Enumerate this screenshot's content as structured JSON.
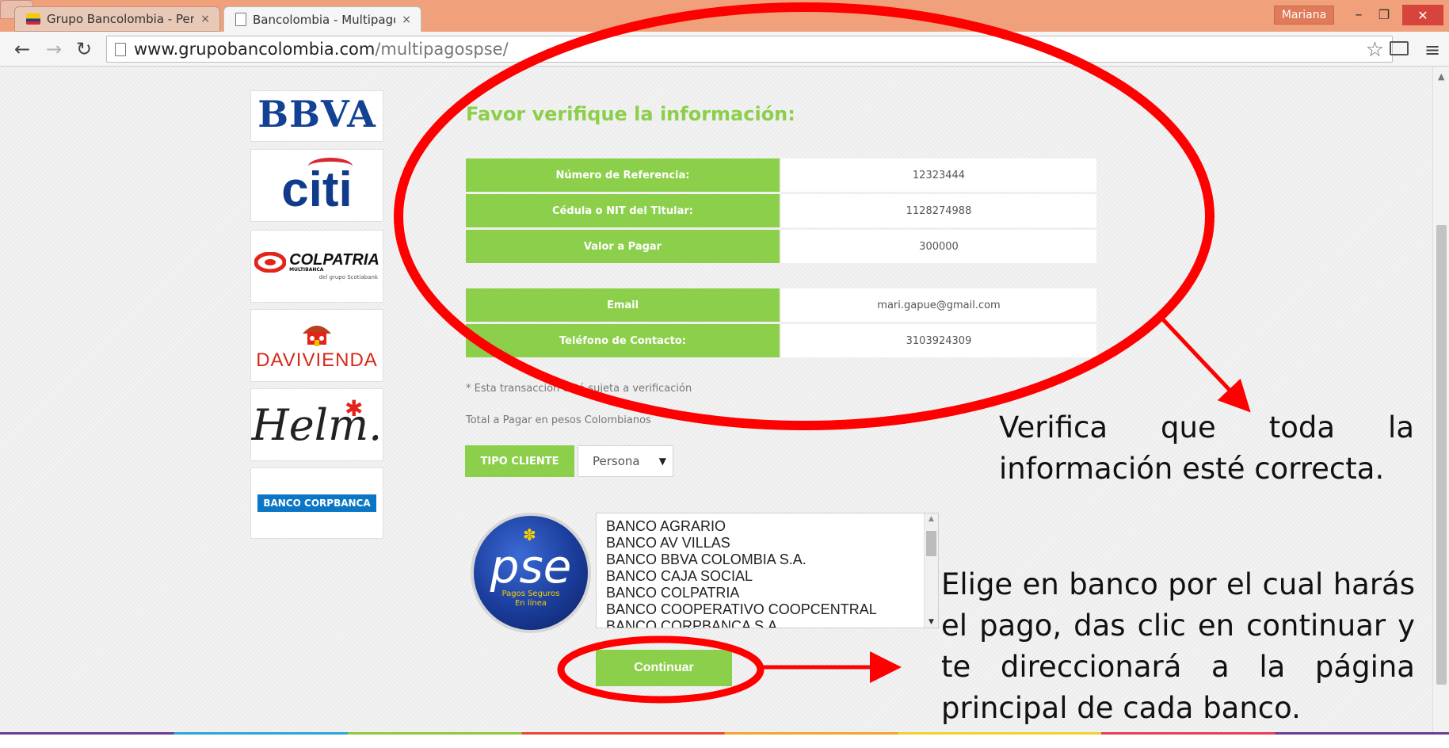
{
  "browser": {
    "tabs": [
      {
        "label": "Grupo Bancolombia - Pers",
        "close": "×"
      },
      {
        "label": "Bancolombia - Multipagos",
        "close": "×"
      }
    ],
    "user": "Mariana",
    "window_buttons": {
      "minimize": "–",
      "maximize": "❐",
      "close": "✕"
    },
    "url_host": "www.grupobancolombia.com",
    "url_path": "/multipagospse/"
  },
  "banks_sidebar": {
    "bbva": "BBVA",
    "citi": "citi",
    "colpatria": "COLPATRIA",
    "colpatria_sub": "MULTIBANCA",
    "colpatria_group": "del grupo Scotiabank",
    "davivienda": "DAVIVIENDA",
    "helm": "Helm.",
    "corpbanca": "BANCO CORPBANCA"
  },
  "verify": {
    "title": "Favor verifique la información:",
    "rows": [
      {
        "label": "Número de Referencia:",
        "value": "12323444"
      },
      {
        "label": "Cédula o NIT del Titular:",
        "value": "1128274988"
      },
      {
        "label": "Valor a Pagar",
        "value": "300000"
      },
      {
        "label": "Email",
        "value": "mari.gapue@gmail.com"
      },
      {
        "label": "Teléfono de Contacto:",
        "value": "3103924309"
      }
    ],
    "note1": "* Esta transacción está sujeta a verificación",
    "note2": "Total a Pagar en pesos Colombianos"
  },
  "client": {
    "tipo_label": "TIPO CLIENTE",
    "tipo_value": "Persona"
  },
  "pse": {
    "word": "pse",
    "sub1": "Pagos Seguros",
    "sub2": "En línea"
  },
  "bank_list": [
    "BANCO AGRARIO",
    "BANCO AV VILLAS",
    "BANCO BBVA COLOMBIA S.A.",
    "BANCO CAJA SOCIAL",
    "BANCO COLPATRIA",
    "BANCO COOPERATIVO COOPCENTRAL",
    "BANCO CORPBANCA S.A"
  ],
  "continue_label": "Continuar",
  "annotations": {
    "first": "Verifica que toda la información esté correcta.",
    "second": "Elige en banco por el cual harás el pago, das clic en continuar y te direccionará a la página principal de cada banco."
  },
  "colors": {
    "green": "#8ccf4a",
    "annotation_red": "#ff0000",
    "titlebar": "#f0a07a"
  }
}
